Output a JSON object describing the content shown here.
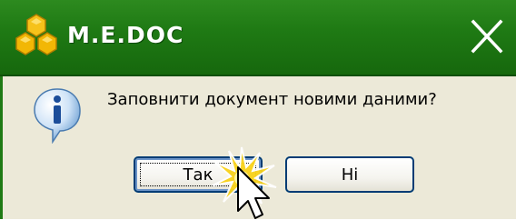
{
  "window": {
    "title": "M.E.DOC",
    "close_icon": "close-icon",
    "logo_icon": "medoc-honeycomb-logo"
  },
  "dialog": {
    "message": "Заповнити документ новими даними?",
    "icon": "info-icon",
    "buttons": {
      "yes_label": "Так",
      "no_label": "Ні"
    }
  },
  "colors": {
    "titlebar": "#1f7a14",
    "dialog_bg": "#ece9d8",
    "button_border": "#003c74",
    "logo": "#f2b705",
    "click_flash": "#f5c400"
  }
}
